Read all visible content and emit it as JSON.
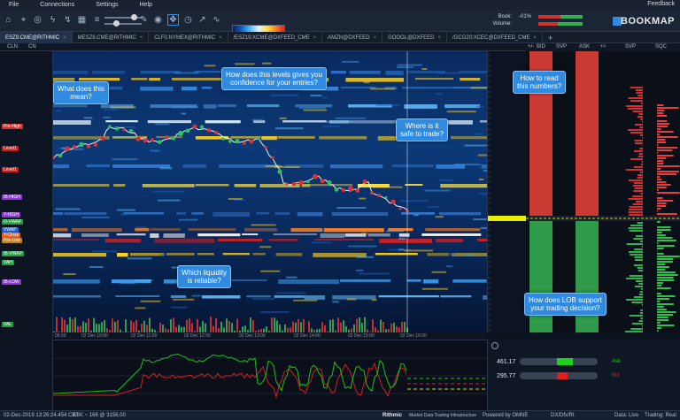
{
  "menubar": {
    "items": [
      "File",
      "Connections",
      "Settings",
      "Help"
    ],
    "feedback": "Feedback"
  },
  "toolbar": {
    "brand": "BOOKMAP",
    "book_label": "Book:",
    "book_value": "-01%",
    "volume_label": "Volume:",
    "icons": [
      "home-icon",
      "crosshair-icon",
      "target-icon",
      "flash-icon",
      "lightning-icon",
      "grid-icon",
      "slider-icon",
      "pencil-icon",
      "record-icon",
      "flag-icon",
      "cursor-icon",
      "clock-icon",
      "brush-icon",
      "trend-icon"
    ]
  },
  "tabs": [
    {
      "label": "ESZ9.CME@RITHMIC",
      "active": true
    },
    {
      "label": "MESZ9.CME@RITHMIC",
      "active": false
    },
    {
      "label": "CLF0.NYMEX@RITHMIC",
      "active": false
    },
    {
      "label": "/ESZ19:XCME@DXFEED_CME",
      "active": false
    },
    {
      "label": "AMZN@DXFEED",
      "active": false
    },
    {
      "label": "GOOGL@DXFEED",
      "active": false
    },
    {
      "label": "/GCG20:XCEC@DXFEED_CME",
      "active": false
    }
  ],
  "add_tab": "+",
  "subbar": {
    "left1": "CLN",
    "left2": "CN"
  },
  "dom_header": {
    "cols": [
      "+/-",
      "BID",
      "SVP",
      "ASK",
      "+/-",
      "SVP",
      "SQC"
    ]
  },
  "levels": [
    {
      "label": "Pre-High",
      "color": "#d03030"
    },
    {
      "label": "Level1",
      "color": "#c02020"
    },
    {
      "label": "Level1",
      "color": "#c02020"
    },
    {
      "label": "IB-HIGH",
      "color": "#8a3ad0"
    },
    {
      "label": "Y-HIGH",
      "color": "#8a3ad0"
    },
    {
      "label": "O-VWAP",
      "color": "#20a040"
    },
    {
      "label": "VWAP",
      "color": "#2060d0"
    },
    {
      "label": "Y-Close",
      "color": "#e06020"
    },
    {
      "label": "Pre-Low",
      "color": "#c08020"
    },
    {
      "label": "IB-VWAP",
      "color": "#20a040"
    },
    {
      "label": "VAH",
      "color": "#20a040"
    },
    {
      "label": "IB-LOW",
      "color": "#8a3ad0"
    },
    {
      "label": "VAL",
      "color": "#20a040"
    }
  ],
  "time_ticks": [
    "06:00",
    "02 Dec 10:00",
    "02 Dec 11:00",
    "02 Dec 12:00",
    "02 Dec 13:00",
    "02 Dec 14:00",
    "02 Dec 15:00",
    "02 Dec 16:00"
  ],
  "callouts": {
    "c1": "What does this\nmean?",
    "c2": "How does this levels gives you\nconfidence for your entries?",
    "c3": "Where is it\nsafe to trade?",
    "c4": "Which liquidity\nis reliable?",
    "c5": "How to read\nthis numbers?",
    "c6": "How does LOB support\nyour trading decision?"
  },
  "balance": {
    "ask_value": "461.17",
    "bid_value": "295.77",
    "ask_label": "Ask",
    "bid_label": "Bid",
    "ask_color": "#20d020",
    "bid_color": "#e02020"
  },
  "status": {
    "datetime": "02-Dec-2019 13:26:24.454 CET",
    "ask_info": "ASK ~ 166 @ 3156.00",
    "provider": "Rithmic",
    "provider_note": "Market Data Trading Infrastructure",
    "powered": "Powered by OMNE",
    "feed": "DX/Dfx/Rt",
    "data": "Data: Live",
    "trading": "Trading: Real"
  },
  "colors": {
    "accent": "#2f8ae0",
    "bid": "#c83a32",
    "ask": "#2f9a4a"
  }
}
